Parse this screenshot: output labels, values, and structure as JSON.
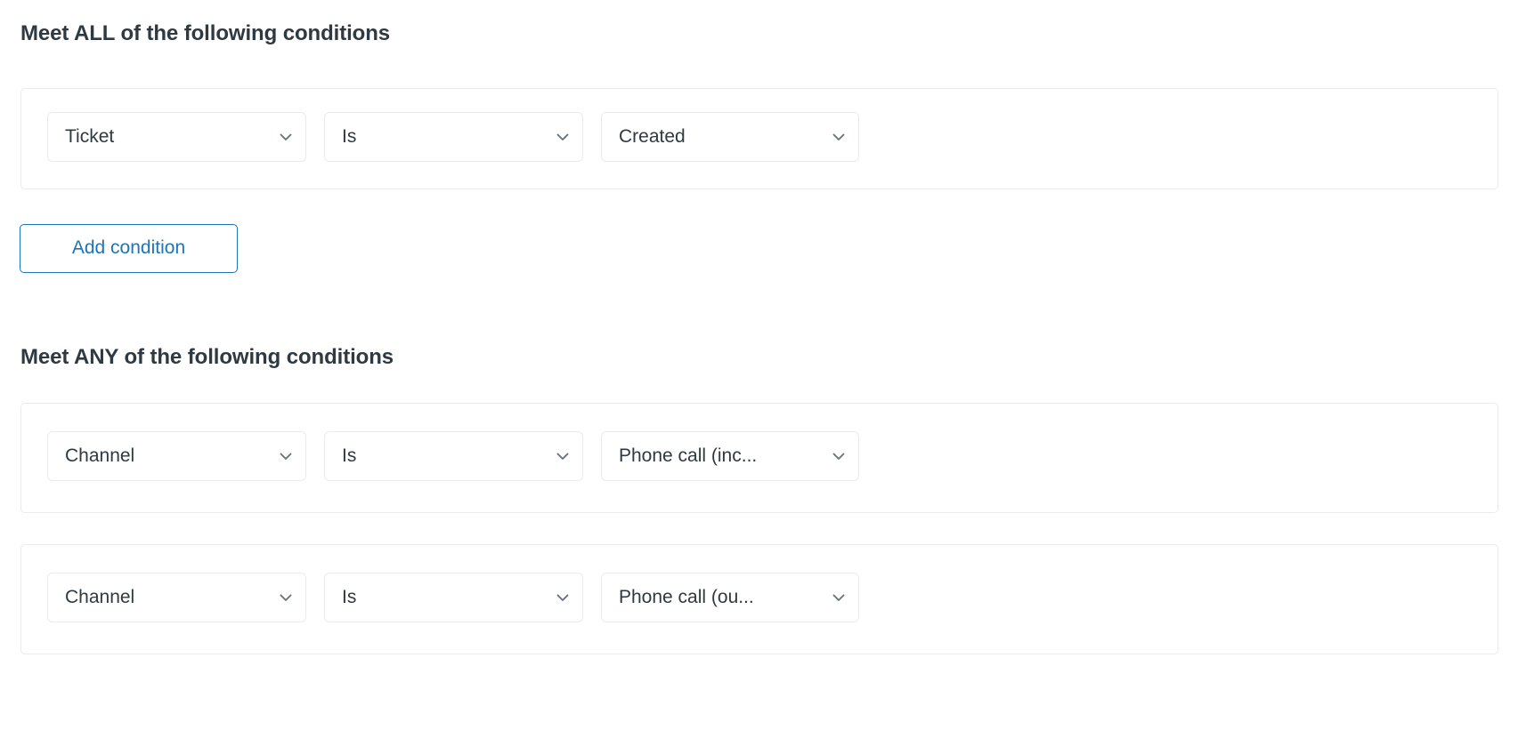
{
  "colors": {
    "heading_text": "#2f3941",
    "border": "#e9ebed",
    "accent_blue": "#1f73b7",
    "chevron_gray": "#68737d",
    "background": "#ffffff"
  },
  "all_section": {
    "heading": "Meet ALL of the following conditions",
    "conditions": [
      {
        "attribute": "Ticket",
        "operator": "Is",
        "value": "Created",
        "attribute_icon": "chevron-down-icon",
        "operator_icon": "chevron-down-icon",
        "value_icon": "chevron-down-icon"
      }
    ],
    "add_condition_label": "Add condition"
  },
  "any_section": {
    "heading": "Meet ANY of the following conditions",
    "conditions": [
      {
        "attribute": "Channel",
        "operator": "Is",
        "value": "Phone call (inc...",
        "attribute_icon": "chevron-down-icon",
        "operator_icon": "chevron-down-icon",
        "value_icon": "chevron-down-icon"
      },
      {
        "attribute": "Channel",
        "operator": "Is",
        "value": "Phone call (ou...",
        "attribute_icon": "chevron-down-icon",
        "operator_icon": "chevron-down-icon",
        "value_icon": "chevron-down-icon"
      }
    ]
  }
}
